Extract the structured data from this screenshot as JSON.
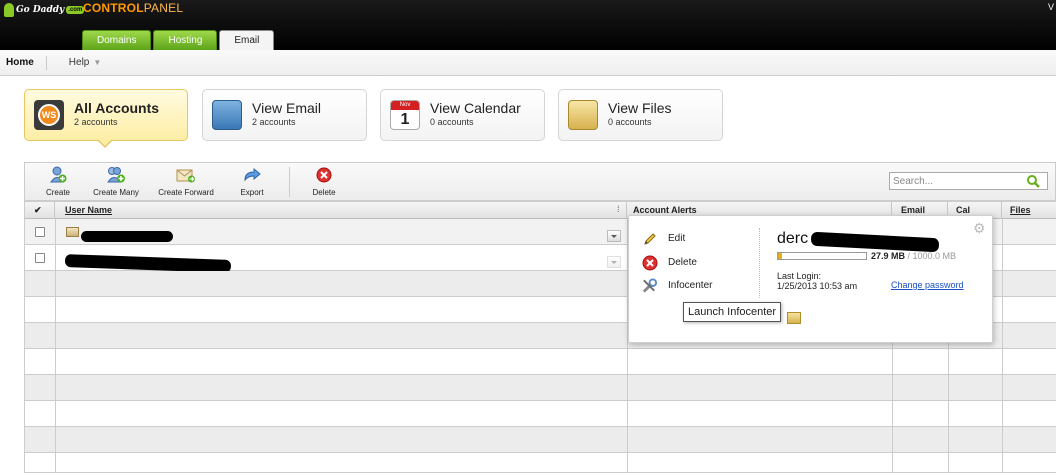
{
  "header": {
    "logo_text": "Go Daddy",
    "logo_badge": ".com",
    "product_title_bold": "CONTROL",
    "product_title_thin": "PANEL",
    "corner_text": "V",
    "tabs": [
      {
        "label": "Domains"
      },
      {
        "label": "Hosting"
      },
      {
        "label": "Email"
      }
    ]
  },
  "nav": {
    "home": "Home",
    "help": "Help",
    "help_caret": "▼"
  },
  "tiles": [
    {
      "title": "All Accounts",
      "sub": "2 accounts",
      "icon": "workspace-icon"
    },
    {
      "title": "View Email",
      "sub": "2 accounts",
      "icon": "email-icon"
    },
    {
      "title": "View Calendar",
      "sub": "0 accounts",
      "icon": "calendar-icon",
      "cal_month": "Nov",
      "cal_day": "1"
    },
    {
      "title": "View Files",
      "sub": "0 accounts",
      "icon": "files-icon"
    }
  ],
  "toolbar": {
    "create": "Create",
    "create_many": "Create Many",
    "create_forward": "Create Forward",
    "export": "Export",
    "delete": "Delete",
    "search_placeholder": "Search..."
  },
  "table": {
    "check_all": "✔",
    "columns": {
      "user_name": "User Name",
      "col_grip": "⁞",
      "account_alerts": "Account Alerts",
      "email": "Email",
      "cal": "Cal",
      "files": "Files"
    }
  },
  "popup": {
    "edit": "Edit",
    "delete": "Delete",
    "infocenter": "Infocenter",
    "account_name": "derc",
    "usage_fraction": 0.028,
    "usage_used": "27.9 MB",
    "usage_sep": " / ",
    "usage_total": "1000.0 MB",
    "last_login_label": "Last Login:",
    "last_login_value": "1/25/2013 10:53 am",
    "change_password": "Change password",
    "gear": "⚙"
  },
  "tooltip": {
    "text": "Launch Infocenter"
  },
  "colors": {
    "accent_orange": "#ff9900",
    "tab_green": "#5da419",
    "link_blue": "#1a4fc4"
  }
}
